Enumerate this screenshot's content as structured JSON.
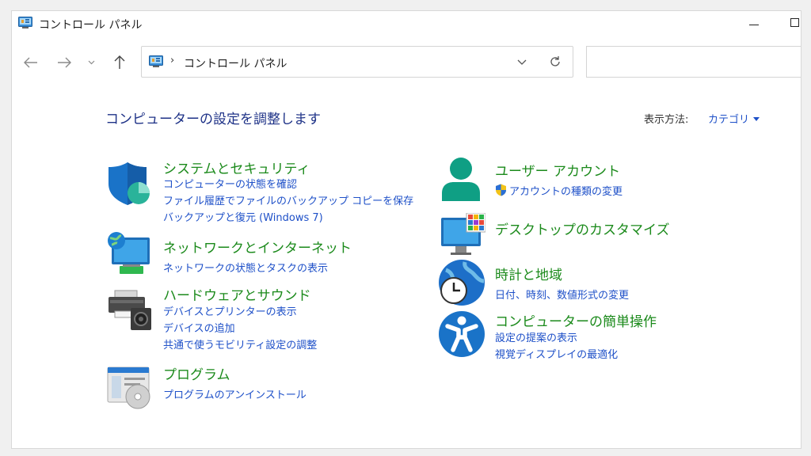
{
  "window": {
    "title": "コントロール パネル"
  },
  "address": {
    "separator": "›",
    "path": "コントロール パネル"
  },
  "search": {
    "placeholder": ""
  },
  "header": {
    "title": "コンピューターの設定を調整します",
    "view_by_label": "表示方法:",
    "view_by_value": "カテゴリ"
  },
  "categories": {
    "system": {
      "title": "システムとセキュリティ",
      "links": [
        "コンピューターの状態を確認",
        "ファイル履歴でファイルのバックアップ コピーを保存",
        "バックアップと復元 (Windows 7)"
      ]
    },
    "network": {
      "title": "ネットワークとインターネット",
      "links": [
        "ネットワークの状態とタスクの表示"
      ]
    },
    "hardware": {
      "title": "ハードウェアとサウンド",
      "links": [
        "デバイスとプリンターの表示",
        "デバイスの追加",
        "共通で使うモビリティ設定の調整"
      ]
    },
    "programs": {
      "title": "プログラム",
      "links": [
        "プログラムのアンインストール"
      ]
    },
    "users": {
      "title": "ユーザー アカウント",
      "links": [
        "アカウントの種類の変更"
      ]
    },
    "desktop": {
      "title": "デスクトップのカスタマイズ",
      "links": []
    },
    "clock": {
      "title": "時計と地域",
      "links": [
        "日付、時刻、数値形式の変更"
      ]
    },
    "ease": {
      "title": "コンピューターの簡単操作",
      "links": [
        "設定の提案の表示",
        "視覚ディスプレイの最適化"
      ]
    }
  },
  "icons": {
    "back": "arrow-left-icon",
    "forward": "arrow-right-icon",
    "recent": "chevron-down-icon",
    "up": "arrow-up-icon",
    "refresh": "refresh-icon",
    "shield": "uac-shield-icon"
  },
  "colors": {
    "category_title": "#1b8a1b",
    "link": "#1e50c8",
    "page_title": "#1e3287"
  }
}
